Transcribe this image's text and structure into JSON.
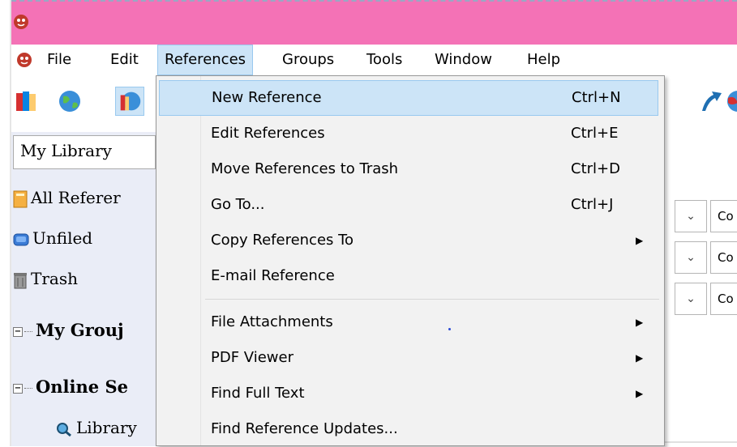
{
  "menubar": {
    "items": [
      "File",
      "Edit",
      "References",
      "Groups",
      "Tools",
      "Window",
      "Help"
    ]
  },
  "left_panel": {
    "library_selector": "My Library",
    "tree": [
      {
        "label": "All Referer",
        "icon": "folder-icon"
      },
      {
        "label": "Unfiled",
        "icon": "unfiled-icon"
      },
      {
        "label": "Trash",
        "icon": "trash-icon"
      }
    ],
    "groups": [
      {
        "label": "My Grouj"
      },
      {
        "label": "Online Se"
      }
    ],
    "online_child": "Library"
  },
  "references_menu": {
    "items": [
      {
        "label": "New Reference",
        "shortcut": "Ctrl+N",
        "submenu": false,
        "highlighted": true
      },
      {
        "label": "Edit References",
        "shortcut": "Ctrl+E",
        "submenu": false
      },
      {
        "label": "Move References to Trash",
        "shortcut": "Ctrl+D",
        "submenu": false
      },
      {
        "label": "Go To...",
        "shortcut": "Ctrl+J",
        "submenu": false
      },
      {
        "label": "Copy References To",
        "shortcut": "",
        "submenu": true
      },
      {
        "label": "E-mail Reference",
        "shortcut": "",
        "submenu": false
      },
      {
        "label": "File Attachments",
        "shortcut": "",
        "submenu": true
      },
      {
        "label": "PDF Viewer",
        "shortcut": "",
        "submenu": true
      },
      {
        "label": "Find Full Text",
        "shortcut": "",
        "submenu": true
      },
      {
        "label": "Find Reference Updates...",
        "shortcut": "",
        "submenu": false
      }
    ]
  },
  "search_fields": [
    {
      "value": "Co"
    },
    {
      "value": "Co"
    },
    {
      "value": "Co"
    }
  ],
  "colors": {
    "titlebar": "#f472b6",
    "highlight": "#cce4f7",
    "left_panel": "#eaedf7"
  }
}
